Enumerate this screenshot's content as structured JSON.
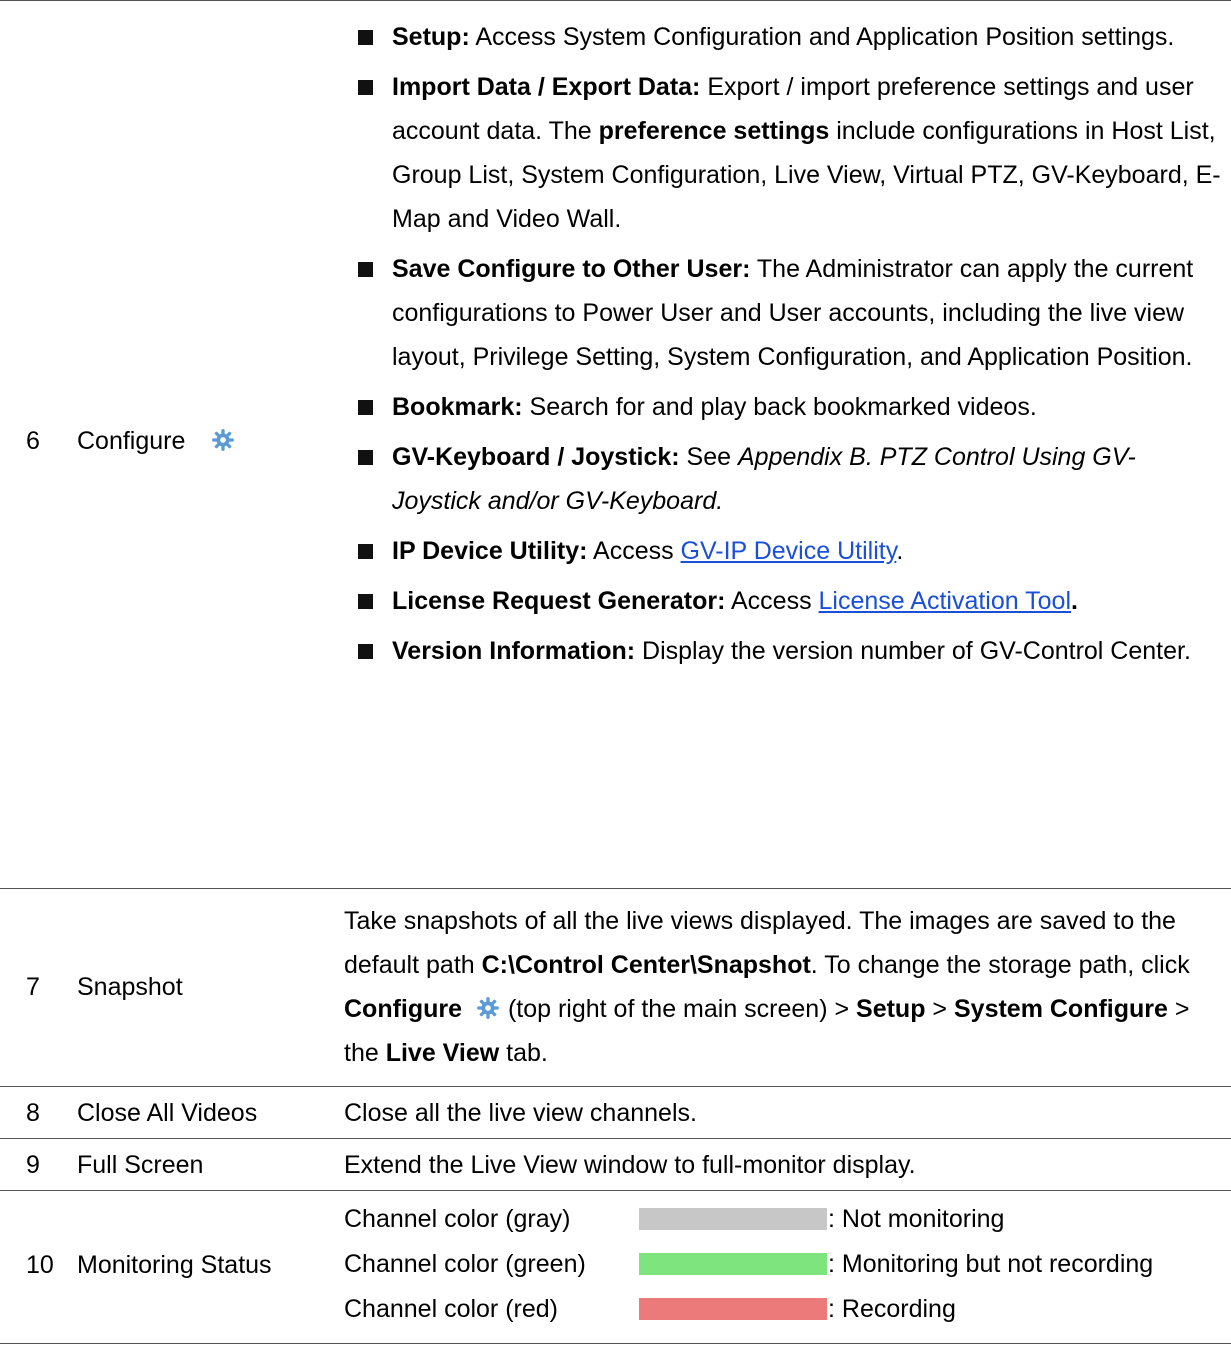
{
  "colors": {
    "gray": "#c7c7c7",
    "green": "#7ee57e",
    "red": "#ec7a7a",
    "link": "#1a4fd8",
    "gear": "#5b9bd5"
  },
  "rows": {
    "r6": {
      "num": "6",
      "item": "Configure",
      "icon": "gear-icon",
      "bullets": [
        {
          "bold": "Setup:",
          "text": " Access System Configuration and Application Position settings."
        },
        {
          "bold": "Import Data / Export Data:",
          "text": " Export / import preference settings and user account data. The ",
          "bold2": "preference settings",
          "text2": " include configurations in Host List, Group List, System Configuration, Live View, Virtual PTZ, GV-Keyboard, E-Map and Video Wall."
        },
        {
          "bold": "Save Configure to Other User:",
          "text": " The Administrator can apply the current configurations to Power User and User accounts, including the live view layout, Privilege Setting, System Configuration, and Application Position."
        },
        {
          "bold": "Bookmark:",
          "text": " Search for and play back bookmarked videos."
        },
        {
          "bold": "GV-Keyboard / Joystick:",
          "text": " See ",
          "italic": "Appendix B. PTZ Control Using GV-Joystick and/or GV-Keyboard."
        },
        {
          "bold": "IP Device Utility:",
          "text": " Access ",
          "link": "GV-IP Device Utility",
          "after": "."
        },
        {
          "bold": "License Request Generator:",
          "text": " Access ",
          "link": "License Activation Tool",
          "after_bold": "."
        },
        {
          "bold": "Version Information:",
          "text": " Display the version number of GV-Control Center."
        }
      ]
    },
    "r7": {
      "num": "7",
      "item": "Snapshot",
      "p1": "Take snapshots of all the live views displayed. The images are saved to the default path ",
      "path": "C:\\Control Center\\Snapshot",
      "p2": ". To change the storage path, click ",
      "configure": "Configure",
      "p3": " (top right of the main screen) > ",
      "setup": "Setup",
      "gt1": " > ",
      "sysconf": "System Configure",
      "gt2": " > the ",
      "liveview": "Live View",
      "tab": " tab."
    },
    "r8": {
      "num": "8",
      "item": "Close All Videos",
      "desc": "Close all the live view channels."
    },
    "r9": {
      "num": "9",
      "item": "Full Screen",
      "desc": "Extend the Live View window to full-monitor display."
    },
    "r10": {
      "num": "10",
      "item": "Monitoring Status",
      "lines": [
        {
          "label": "Channel color (gray)",
          "status": ": Not monitoring"
        },
        {
          "label": "Channel color (green)",
          "status": ": Monitoring but not recording"
        },
        {
          "label": "Channel color (red)",
          "status": ": Recording"
        }
      ]
    }
  }
}
